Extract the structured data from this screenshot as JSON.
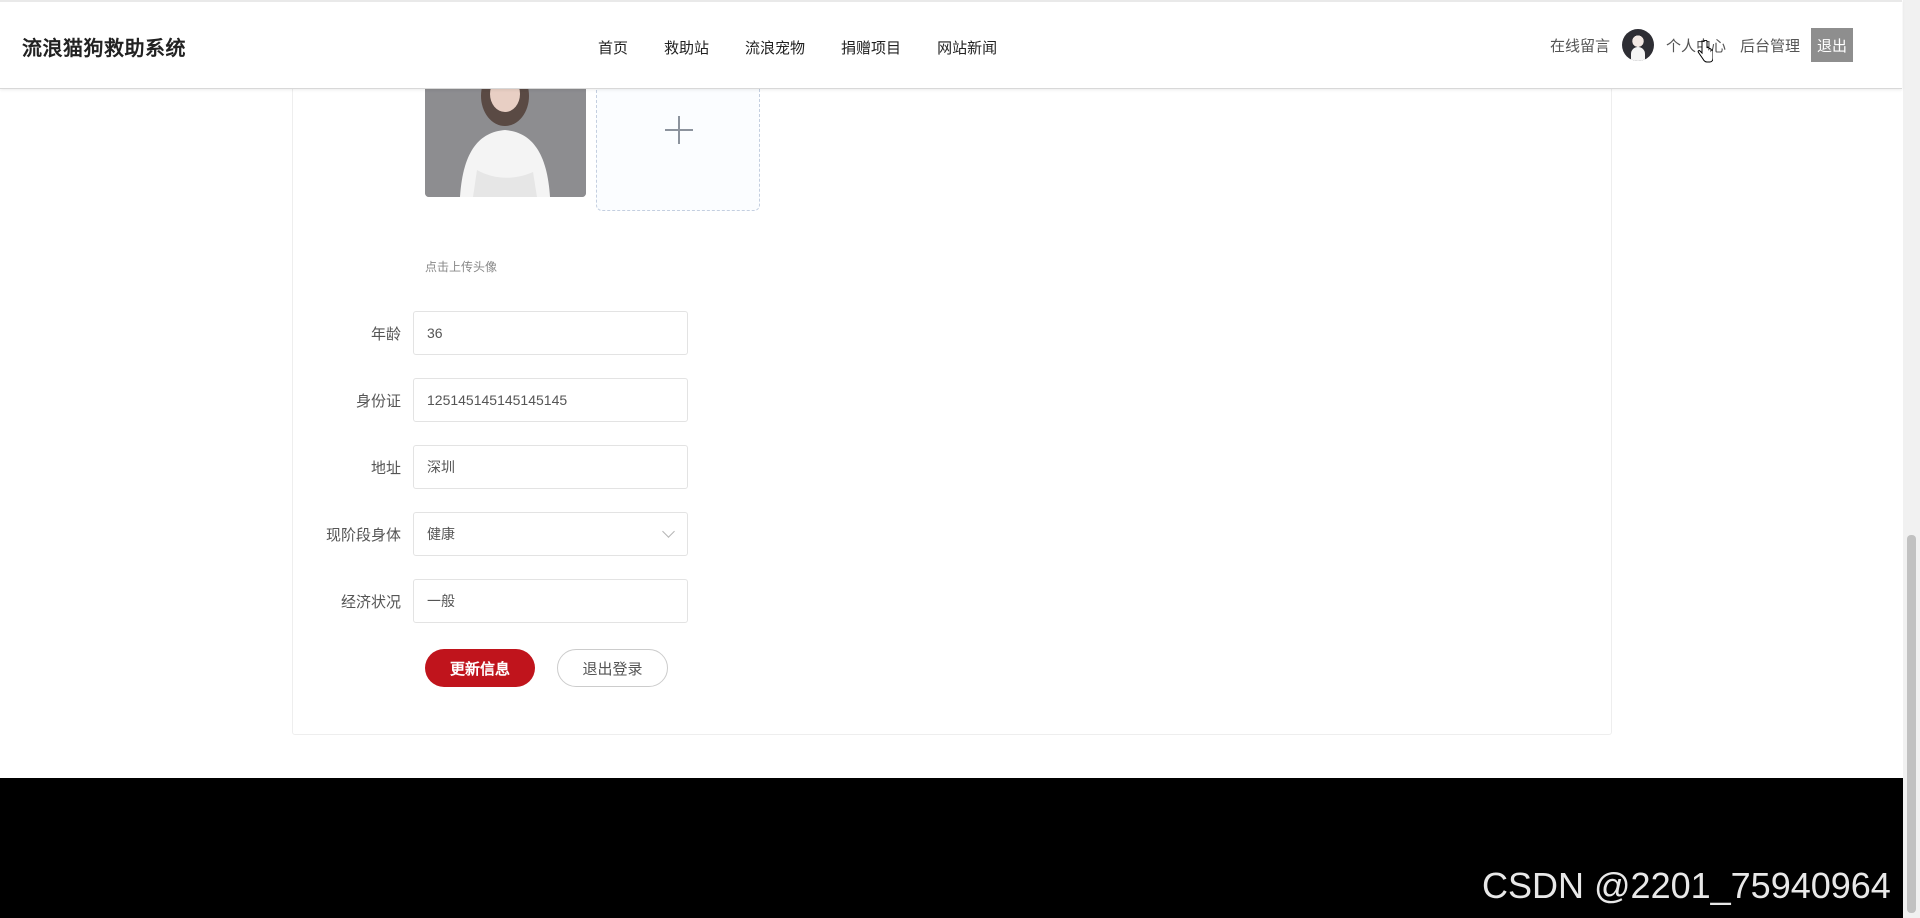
{
  "header": {
    "brand": "流浪猫狗救助系统",
    "nav": [
      "首页",
      "救助站",
      "流浪宠物",
      "捐赠项目",
      "网站新闻"
    ],
    "online_message": "在线留言",
    "personal_center": "个人中心",
    "admin": "后台管理",
    "logout": "退出"
  },
  "profile": {
    "upload_tip": "点击上传头像",
    "fields": [
      {
        "label": "年龄",
        "value": "36"
      },
      {
        "label": "身份证",
        "value": "125145145145145145"
      },
      {
        "label": "地址",
        "value": "深圳"
      },
      {
        "label": "现阶段身体",
        "value": "健康",
        "type": "select"
      },
      {
        "label": "经济状况",
        "value": "一般"
      }
    ],
    "update_button": "更新信息",
    "logout_button": "退出登录"
  },
  "watermark": "CSDN @2201_75940964",
  "colors": {
    "primary": "#c0141c",
    "footer": "#000000",
    "logout_bg": "#8e8e8e"
  },
  "icons": [
    "plus-icon",
    "chevron-down-icon",
    "pointer-cursor-icon"
  ]
}
